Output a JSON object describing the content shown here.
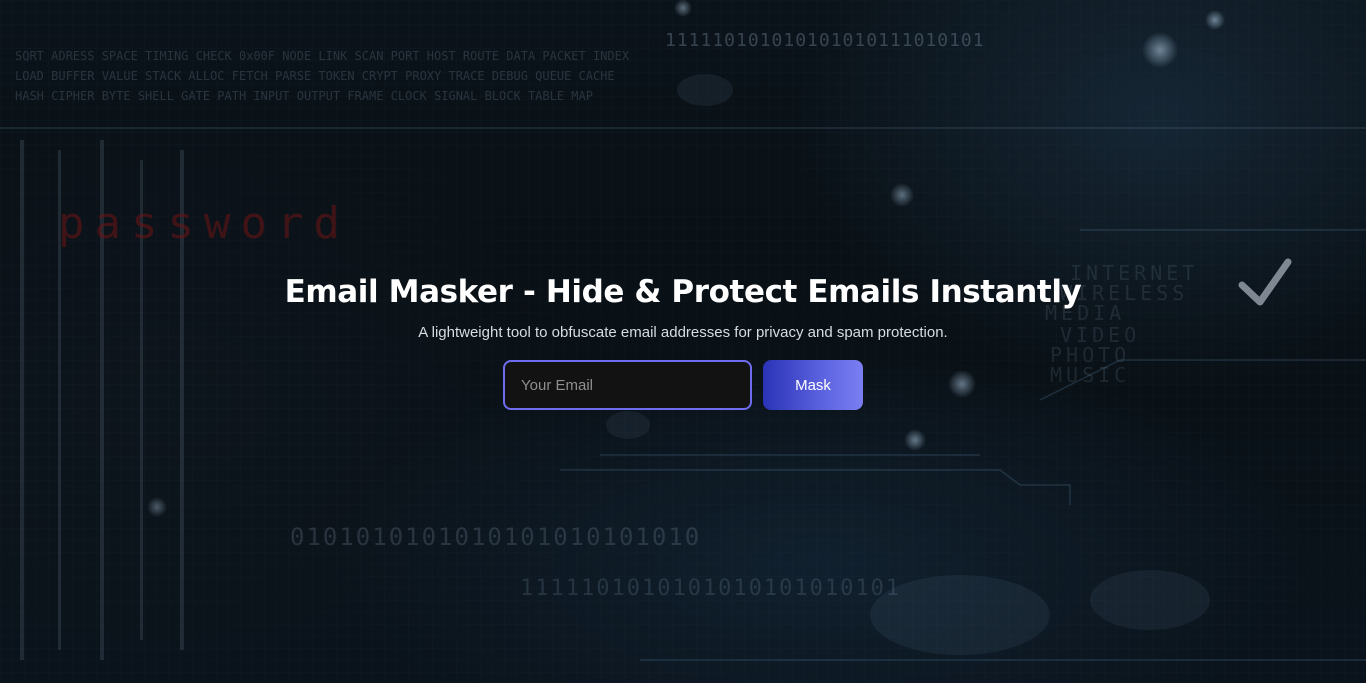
{
  "hero": {
    "title": "Email Masker - Hide & Protect Emails Instantly",
    "subtitle": "A lightweight tool to obfuscate email addresses for privacy and spam protection."
  },
  "form": {
    "email_placeholder": "Your Email",
    "email_value": "",
    "mask_label": "Mask"
  },
  "background": {
    "password_text": "password",
    "binary_top": "111110101010101010111010101",
    "binary_mid": "0101010101010101010101010",
    "binary_low": "1111101010101010101010101",
    "side_words": [
      "INTERNET",
      "WIRELESS",
      "MEDIA",
      "VIDEO",
      "PHOTO",
      "MUSIC"
    ],
    "accent_color": "#6f6cf0",
    "password_color": "#6b1414"
  }
}
